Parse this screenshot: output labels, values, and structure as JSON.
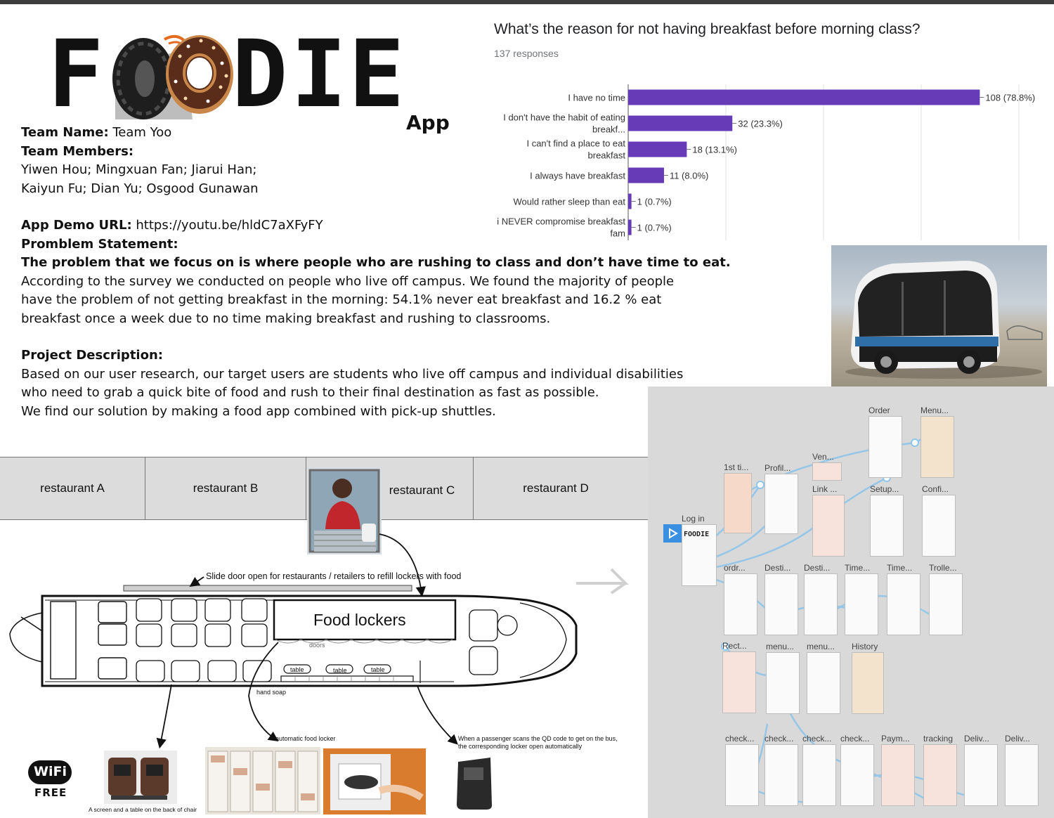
{
  "logo": {
    "letters": [
      "F",
      "D",
      "I",
      "E"
    ],
    "app_label": "App"
  },
  "team": {
    "name_label": "Team Name:",
    "name_value": "Team Yoo",
    "members_label": "Team Members:",
    "members_line1": "Yiwen Hou; Mingxuan Fan; Jiarui Han;",
    "members_line2": "Kaiyun Fu; Dian Yu; Osgood Gunawan"
  },
  "demo": {
    "label": "App Demo URL:",
    "url": "https://youtu.be/hldC7aXFyFY"
  },
  "problem": {
    "label": "Promblem Statement:",
    "bold_line": "The problem that we focus on is where people who are rushing to class and don’t have time to eat.",
    "lines": [
      "According to the survey we conducted on people who live off campus. We found the majority of people",
      "have the problem of not getting breakfast in the morning: 54.1% never eat breakfast and 16.2 % eat",
      "breakfast once a week due to no time making breakfast and rushing to classrooms."
    ]
  },
  "project": {
    "label": "Project Description:",
    "lines": [
      "Based on our user research, our target users are students who live off campus and individual disabilities",
      "who need to grab a quick bite of food and rush to their final destination as fast as possible.",
      "We find our solution by making a food app combined with pick-up shuttles."
    ]
  },
  "chart_data": {
    "type": "bar",
    "orientation": "horizontal",
    "title": "What’s the reason for not having breakfast before morning class?",
    "subtitle": "137 responses",
    "categories": [
      [
        "I have no time"
      ],
      [
        "I don't have the habit of eating",
        "breakf..."
      ],
      [
        "I can't find a place to eat",
        "breakfast"
      ],
      [
        "I always have breakfast"
      ],
      [
        "Would rather sleep than eat"
      ],
      [
        "i NEVER compromise breakfast",
        "fam"
      ]
    ],
    "values": [
      108,
      32,
      18,
      11,
      1,
      1
    ],
    "value_labels": [
      "108 (78.8%)",
      "32 (23.3%)",
      "18 (13.1%)",
      "11 (8.0%)",
      "1 (0.7%)",
      "1 (0.7%)"
    ],
    "xlim": [
      0,
      120
    ],
    "grid": true,
    "legend": "none",
    "bar_color": "#673ab7"
  },
  "restaurants": [
    "restaurant A",
    "restaurant B",
    "restaurant C",
    "restaurant D"
  ],
  "bus": {
    "slide_door_note": "Slide door open for restaurants / retailers to refill  lockers with food",
    "food_lockers": "Food lockers",
    "doors": "doors",
    "table": "table",
    "hand_soap": "hand soap",
    "automatic_locker": "automatic food locker",
    "scan_note_1": "When a passenger scans the QD code to get on the bus,",
    "scan_note_2": "the corresponding locker open automatically",
    "chair_note": "A screen and a table on the back of chair"
  },
  "wifi": {
    "label": "WiFi",
    "free": "FREE"
  },
  "wireframes": {
    "login_label": "Log in",
    "mini_logo": "FOODIE",
    "screens": [
      "Order",
      "Menu...",
      "1st ti...",
      "Profil...",
      "Ven...",
      "Link ...",
      "Setup...",
      "Confi...",
      "ordr...",
      "Desti...",
      "Desti...",
      "Time...",
      "Time...",
      "Trolle...",
      "Rect...",
      "menu...",
      "menu...",
      "History",
      "check...",
      "check...",
      "check...",
      "check...",
      "Paym...",
      "tracking",
      "Deliv...",
      "Deliv..."
    ]
  },
  "colors": {
    "bar": "#673ab7",
    "grid": "#e0e0e0",
    "panel": "#d9d9d9",
    "flow": "#8ec5ea"
  }
}
